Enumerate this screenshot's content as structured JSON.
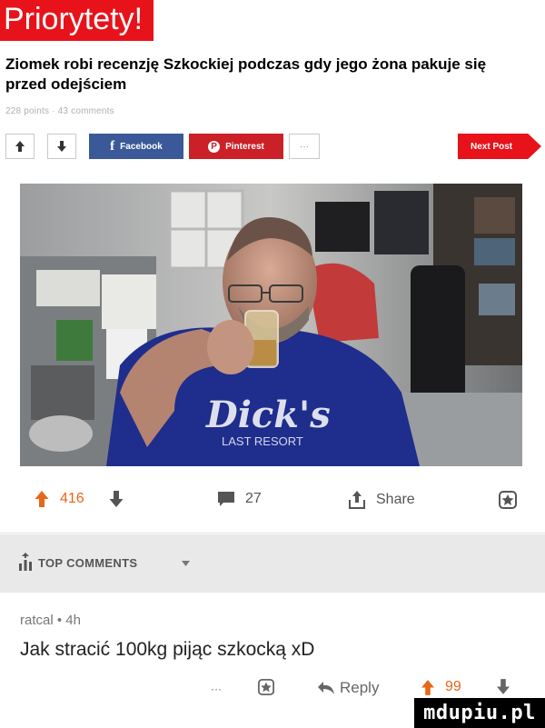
{
  "site": {
    "title": "Priorytety!"
  },
  "post": {
    "title": "Ziomek robi recenzję Szkockiej podczas gdy jego żona pakuje się przed odejściem",
    "meta": "228 points · 43 comments"
  },
  "toolbar": {
    "upvote_icon": "arrow-up-icon",
    "downvote_icon": "arrow-down-icon",
    "facebook_label": "Facebook",
    "pinterest_label": "Pinterest",
    "more_label": "···",
    "next_label": "Next Post"
  },
  "photo": {
    "shirt_text": "Dick's",
    "shirt_subtext": "LAST RESORT"
  },
  "actions": {
    "upvotes": "416",
    "comments": "27",
    "share_label": "Share"
  },
  "comments_section": {
    "label": "TOP COMMENTS"
  },
  "comment": {
    "author": "ratcal",
    "time": "4h",
    "author_line": "ratcal • 4h",
    "text": "Jak stracić 100kg pijąc szkocką xD",
    "more_label": "···",
    "reply_label": "Reply",
    "votes": "99"
  },
  "watermark": {
    "text": "mdupiu.pl"
  },
  "colors": {
    "brand_red": "#e8121b",
    "upvote_orange": "#e8661a",
    "facebook_blue": "#3b5998",
    "pinterest_red": "#cb2027"
  }
}
